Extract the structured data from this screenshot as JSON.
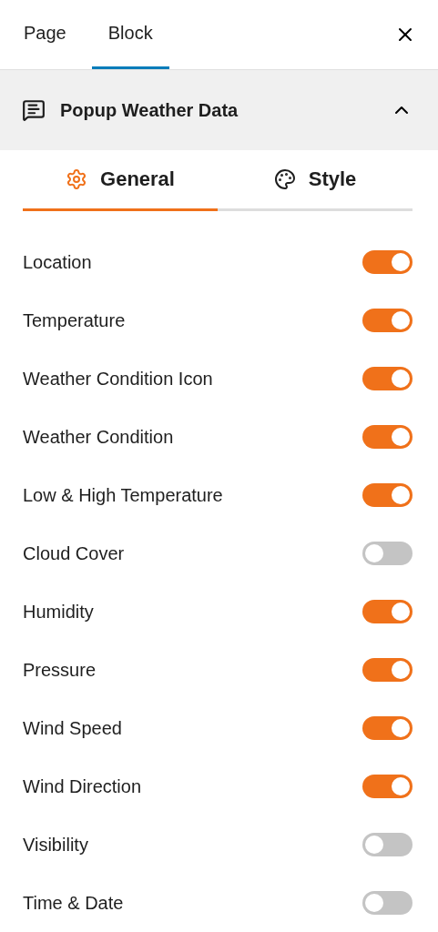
{
  "tabs": [
    {
      "label": "Page",
      "selected": false
    },
    {
      "label": "Block",
      "selected": true
    }
  ],
  "panel": {
    "title": "Popup Weather Data",
    "expanded": true
  },
  "subtabs": [
    {
      "label": "General",
      "selected": true,
      "kind": "gear"
    },
    {
      "label": "Style",
      "selected": false,
      "kind": "palette"
    }
  ],
  "options": [
    {
      "label": "Location",
      "on": true
    },
    {
      "label": "Temperature",
      "on": true
    },
    {
      "label": "Weather Condition Icon",
      "on": true
    },
    {
      "label": "Weather Condition",
      "on": true
    },
    {
      "label": "Low & High Temperature",
      "on": true
    },
    {
      "label": "Cloud Cover",
      "on": false
    },
    {
      "label": "Humidity",
      "on": true
    },
    {
      "label": "Pressure",
      "on": true
    },
    {
      "label": "Wind Speed",
      "on": true
    },
    {
      "label": "Wind Direction",
      "on": true
    },
    {
      "label": "Visibility",
      "on": false
    },
    {
      "label": "Time & Date",
      "on": false
    }
  ]
}
